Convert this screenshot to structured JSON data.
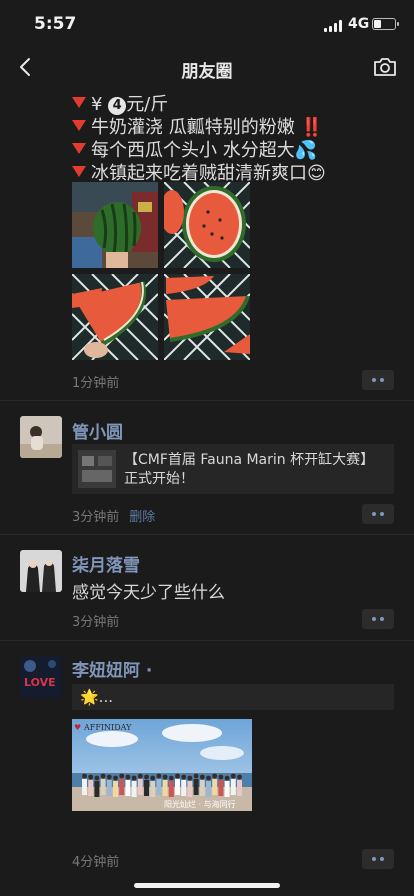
{
  "status": {
    "time": "5:57",
    "network": "4G",
    "battery_level": 0.35
  },
  "nav": {
    "title": "朋友圈"
  },
  "post1": {
    "lines": [
      {
        "text_a": "¥",
        "num": "4",
        "text_b": "元/斤"
      },
      {
        "text": "牛奶灌浇 瓜瓤特别的粉嫩 ‼️"
      },
      {
        "text": "每个西瓜个头小 水分超大💦"
      },
      {
        "text": "冰镇起来吃着贼甜清新爽口😊"
      }
    ],
    "time": "1分钟前",
    "photo_count": 4
  },
  "post2": {
    "name": "管小圆",
    "share_title": "【CMF首届 Fauna Marin 杯开缸大赛】正式开始！",
    "time": "3分钟前",
    "delete_label": "删除"
  },
  "post3": {
    "name": "柒月落雪",
    "body": "感觉今天少了些什么",
    "time": "3分钟前"
  },
  "post4": {
    "name": "李妞妞阿 ·",
    "comment": "🌟...",
    "photo_logo": "AFFINIDAY",
    "photo_caption": "阳光灿烂 · 与海同行",
    "time": "4分钟前"
  },
  "icons": {
    "back": "chevron-left-icon",
    "camera": "camera-icon",
    "more": "more-dots-icon"
  },
  "colors": {
    "background": "#1b1b1b",
    "nickname": "#7f96b8",
    "accent_red": "#e23b2f"
  }
}
